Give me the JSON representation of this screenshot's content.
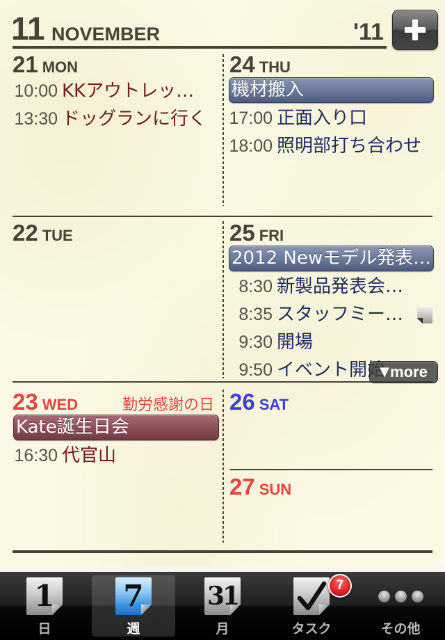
{
  "header": {
    "month_number": "11",
    "month_name": "NOVEMBER",
    "year": "'11",
    "add_button_icon": "plus-icon"
  },
  "week": {
    "days": [
      {
        "date": "21",
        "weekday": "MON",
        "events": [
          {
            "time": "10:00",
            "title": "KKアウトレッ…"
          },
          {
            "time": "13:30",
            "title": "ドッグランに行く"
          }
        ]
      },
      {
        "date": "22",
        "weekday": "TUE",
        "events": []
      },
      {
        "date": "23",
        "weekday": "WED",
        "holiday": "勤労感謝の日",
        "all_day": [
          "Kate誕生日会"
        ],
        "events": [
          {
            "time": "16:30",
            "title": "代官山"
          }
        ]
      },
      {
        "date": "24",
        "weekday": "THU",
        "all_day": [
          "機材搬入"
        ],
        "events": [
          {
            "time": "17:00",
            "title": "正面入り口"
          },
          {
            "time": "18:00",
            "title": "照明部打ち合わせ"
          }
        ]
      },
      {
        "date": "25",
        "weekday": "FRI",
        "all_day": [
          "2012 Newモデル発表…"
        ],
        "events": [
          {
            "time": "8:30",
            "title": "新製品発表会…"
          },
          {
            "time": "8:35",
            "title": "スタッフミー…",
            "icon": "note-icon"
          },
          {
            "time": "9:30",
            "title": "開場"
          },
          {
            "time": "9:50",
            "title": "イベント開始"
          }
        ],
        "more_arrow": "▼",
        "more_label": "more"
      },
      {
        "date": "26",
        "weekday": "SAT",
        "events": []
      },
      {
        "date": "27",
        "weekday": "SUN",
        "events": []
      }
    ]
  },
  "tabbar": {
    "tabs": [
      {
        "label": "日",
        "icon": "day-calendar-icon",
        "icon_text": "1"
      },
      {
        "label": "週",
        "icon": "week-calendar-icon",
        "icon_text": "7",
        "selected": true
      },
      {
        "label": "月",
        "icon": "month-calendar-icon",
        "icon_text": "31"
      },
      {
        "label": "タスク",
        "icon": "checkmark-icon",
        "badge": "7"
      },
      {
        "label": "その他",
        "icon": "more-dots-icon"
      }
    ]
  },
  "colors": {
    "paper": "#fbf9e5",
    "ink": "#4a4038",
    "weekend_red": "#e6443c",
    "saturday_blue": "#3b3fe0",
    "left_event_text": "#6e1c1c",
    "right_event_text": "#1e2c5c",
    "allday_blue": "#6a7899",
    "allday_mauve": "#8d4f57",
    "badge_red": "#e02020",
    "tab_selected_blue": "#3a92dc"
  }
}
